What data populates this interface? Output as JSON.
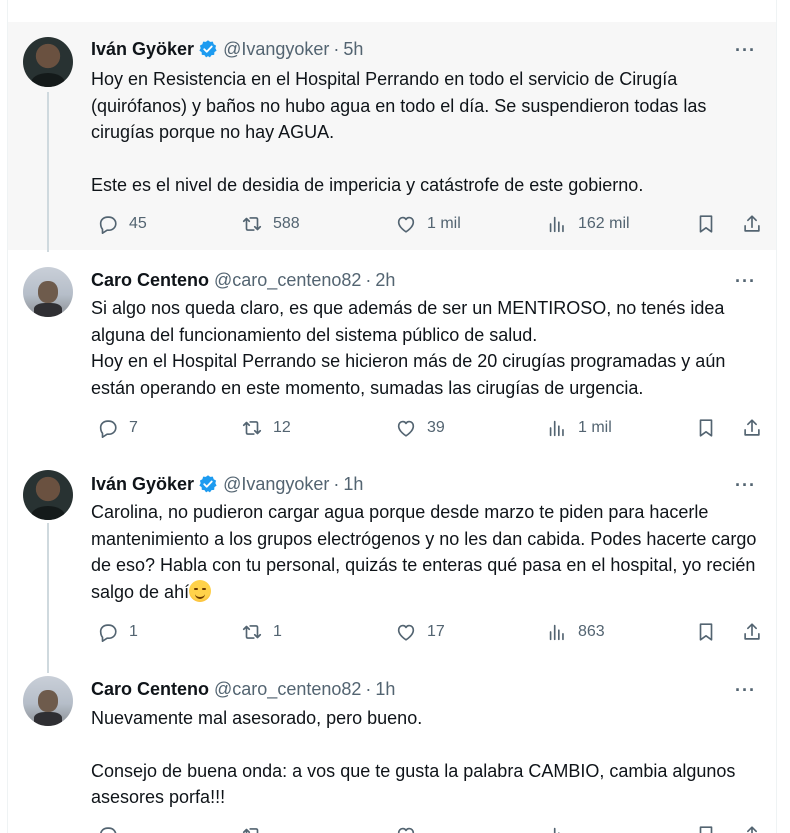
{
  "tweets": [
    {
      "name": "Iván Gyöker",
      "verified": true,
      "handle": "@Ivangyoker",
      "dot": "·",
      "time": "5h",
      "more": "···",
      "paragraphs": [
        "Hoy en Resistencia en el Hospital Perrando en todo el servicio de Cirugía (quirófanos) y baños no hubo agua en todo el día. Se suspendieron todas las cirugías porque no hay AGUA.",
        "Este es el nivel de desidia de impericia y catástrofe de este gobierno."
      ],
      "replies": "45",
      "retweets": "588",
      "likes": "1 mil",
      "views": "162 mil"
    },
    {
      "name": "Caro Centeno",
      "verified": false,
      "handle": "@caro_centeno82",
      "dot": "·",
      "time": "2h",
      "more": "···",
      "paragraphs": [
        "Si algo nos queda claro, es que además de ser un MENTIROSO, no tenés idea alguna del funcionamiento del sistema público de salud.",
        "Hoy en el Hospital Perrando se hicieron más de 20 cirugías programadas y aún están operando en este momento, sumadas las cirugías de urgencia."
      ],
      "replies": "7",
      "retweets": "12",
      "likes": "39",
      "views": "1 mil"
    },
    {
      "name": "Iván Gyöker",
      "verified": true,
      "handle": "@Ivangyoker",
      "dot": "·",
      "time": "1h",
      "more": "···",
      "paragraphs": [
        "Carolina, no pudieron cargar agua porque desde marzo te piden para hacerle mantenimiento a los grupos electrógenos y no les dan cabida. Podes hacerte cargo de eso? Habla con tu personal, quizás te enteras qué pasa en el hospital, yo recién salgo de ahí"
      ],
      "emoji": "smiling-face-with-blush",
      "replies": "1",
      "retweets": "1",
      "likes": "17",
      "views": "863"
    },
    {
      "name": "Caro Centeno",
      "verified": false,
      "handle": "@caro_centeno82",
      "dot": "·",
      "time": "1h",
      "more": "···",
      "paragraphs": [
        "Nuevamente mal asesorado, pero bueno.",
        "Consejo de buena onda: a vos que te gusta la palabra CAMBIO, cambia algunos asesores porfa!!!"
      ]
    }
  ],
  "colors": {
    "text": "#0f1419",
    "muted": "#536471",
    "verified": "#1d9bf0",
    "highlight_bg": "#f7f7f7",
    "thread_line": "#cfd9de"
  },
  "icons": [
    "reply-icon",
    "retweet-icon",
    "like-icon",
    "views-icon",
    "bookmark-icon",
    "share-icon",
    "more-icon",
    "verified-badge-icon"
  ]
}
